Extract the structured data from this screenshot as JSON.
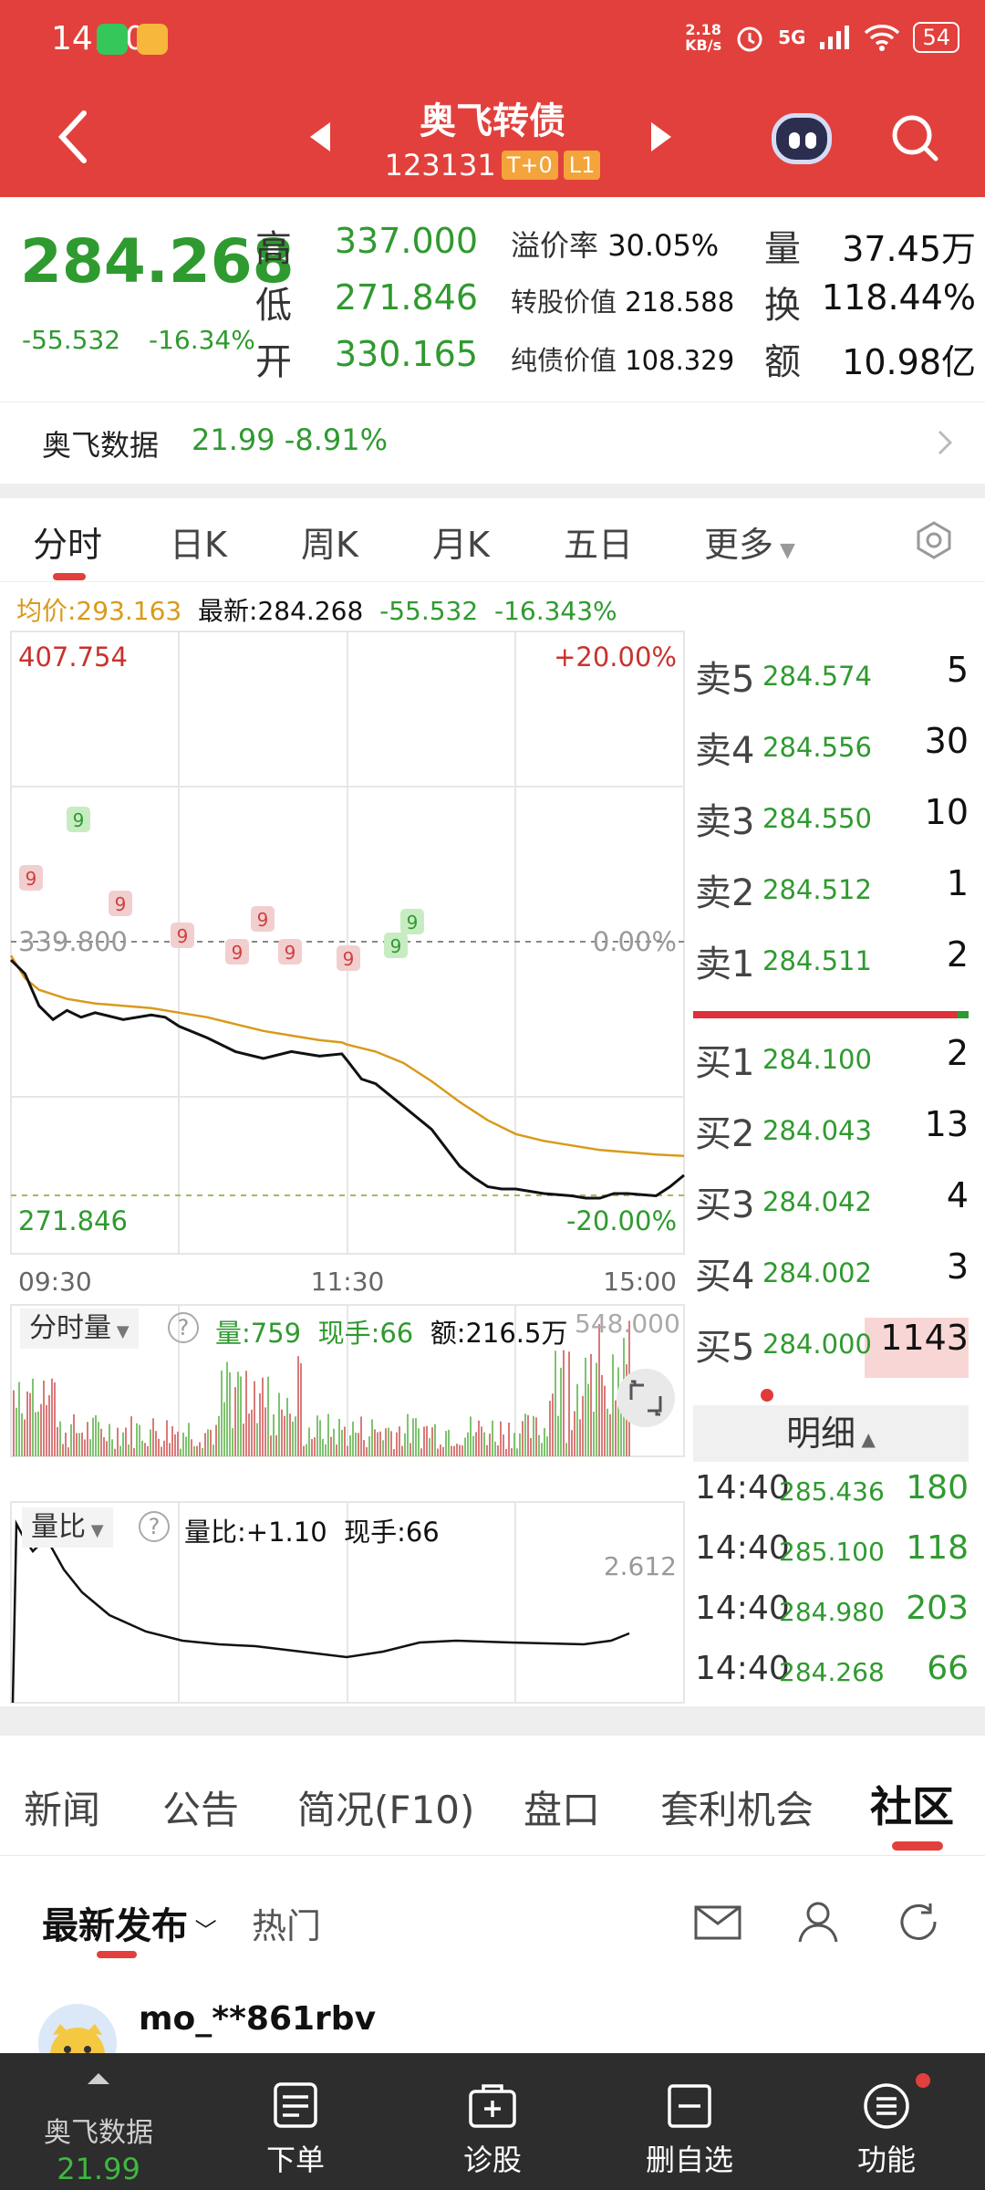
{
  "status": {
    "time": "14:40",
    "net_speed_top": "2.18",
    "net_speed_bottom": "KB/s",
    "signal": "5G",
    "battery": "54"
  },
  "header": {
    "title": "奥飞转债",
    "code": "123131",
    "tag_t0": "T+0",
    "tag_level": "L1"
  },
  "quote": {
    "last": "284.268",
    "change": "-55.532",
    "change_pct": "-16.34%",
    "high_label": "高",
    "high": "337.000",
    "low_label": "低",
    "low": "271.846",
    "open_label": "开",
    "open": "330.165",
    "premium_label": "溢价率",
    "premium": "30.05%",
    "conv_value_label": "转股价值",
    "conv_value": "218.588",
    "bond_value_label": "纯债价值",
    "bond_value": "108.329",
    "volume_label": "量",
    "volume": "37.45万",
    "turnover_label": "换",
    "turnover": "118.44%",
    "amount_label": "额",
    "amount": "10.98亿"
  },
  "stock": {
    "name": "奥飞数据",
    "price": "21.99",
    "change_pct": "-8.91%"
  },
  "period_tabs": [
    "分时",
    "日K",
    "周K",
    "月K",
    "五日",
    "更多"
  ],
  "chart_info": {
    "avg": "均价:293.163",
    "latest": "最新:284.268",
    "chg": "-55.532",
    "chg_pct": "-16.343%"
  },
  "chart_labels": {
    "max": "407.754",
    "max_pct": "+20.00%",
    "prev_close": "339.800",
    "zero_pct": "0.00%",
    "min": "271.846",
    "min_pct": "-20.00%",
    "t_start": "09:30",
    "t_mid": "11:30",
    "t_end": "15:00",
    "vol_label": "分时量",
    "vol_info": "量:759",
    "vol_hand": "现手:66",
    "vol_amt": "额:216.5万",
    "vol_max": "548.000",
    "ratio_label": "量比",
    "ratio_info": "量比:+1.10",
    "ratio_hand": "现手:66",
    "ratio_max": "2.612",
    "marker": "9"
  },
  "chart_data": {
    "type": "line",
    "x_range": [
      "09:30",
      "15:00"
    ],
    "y_range": [
      271.846,
      407.754
    ],
    "prev_close": 339.8,
    "series": [
      {
        "name": "price",
        "color": "#111111",
        "x": [
          0,
          5,
          10,
          15,
          20,
          25,
          30,
          40,
          50,
          55,
          60,
          70,
          80,
          90,
          100,
          110,
          118,
          120,
          125,
          130,
          140,
          150,
          155,
          160,
          165,
          170,
          175,
          180,
          190,
          200,
          205,
          210,
          215,
          220,
          230,
          235,
          240
        ],
        "values": [
          336.0,
          333.0,
          326.0,
          323.0,
          325.0,
          323.5,
          324.5,
          323.0,
          324.0,
          323.5,
          321.5,
          319.0,
          316.0,
          314.5,
          316.0,
          315.0,
          315.5,
          314.0,
          310.0,
          309.0,
          304.0,
          299.0,
          295.0,
          291.0,
          288.5,
          286.5,
          286.0,
          286.0,
          285.0,
          284.5,
          284.0,
          284.0,
          285.0,
          285.0,
          284.5,
          286.5,
          289.0
        ]
      },
      {
        "name": "均价",
        "color": "#d99a1a",
        "x": [
          0,
          5,
          10,
          20,
          30,
          40,
          50,
          60,
          70,
          80,
          90,
          100,
          110,
          118,
          120,
          130,
          140,
          150,
          160,
          170,
          180,
          190,
          200,
          210,
          220,
          230,
          240
        ],
        "values": [
          337.0,
          332.0,
          329.5,
          327.5,
          326.5,
          326.0,
          325.5,
          324.5,
          323.5,
          322.0,
          320.5,
          319.5,
          318.5,
          318.0,
          317.5,
          316.0,
          313.5,
          309.5,
          305.0,
          301.0,
          298.0,
          296.5,
          295.5,
          294.5,
          294.0,
          293.5,
          293.2
        ]
      }
    ]
  },
  "order_book": {
    "asks": [
      {
        "label": "卖5",
        "price": "284.574",
        "qty": "5"
      },
      {
        "label": "卖4",
        "price": "284.556",
        "qty": "30"
      },
      {
        "label": "卖3",
        "price": "284.550",
        "qty": "10"
      },
      {
        "label": "卖2",
        "price": "284.512",
        "qty": "1"
      },
      {
        "label": "卖1",
        "price": "284.511",
        "qty": "2"
      }
    ],
    "bids": [
      {
        "label": "买1",
        "price": "284.100",
        "qty": "2"
      },
      {
        "label": "买2",
        "price": "284.043",
        "qty": "13"
      },
      {
        "label": "买3",
        "price": "284.042",
        "qty": "4"
      },
      {
        "label": "买4",
        "price": "284.002",
        "qty": "3"
      },
      {
        "label": "买5",
        "price": "284.000",
        "qty": "1143"
      }
    ]
  },
  "trade_detail": {
    "header": "明细",
    "rows": [
      {
        "time": "14:40",
        "price": "285.436",
        "qty": "180"
      },
      {
        "time": "14:40",
        "price": "285.100",
        "qty": "118"
      },
      {
        "time": "14:40",
        "price": "284.980",
        "qty": "203"
      },
      {
        "time": "14:40",
        "price": "284.268",
        "qty": "66"
      }
    ]
  },
  "news_tabs": [
    "新闻",
    "公告",
    "简况(F10)",
    "盘口",
    "套利机会",
    "社区"
  ],
  "feed": {
    "latest": "最新发布",
    "hot": "热门",
    "user": "mo_**861rbv"
  },
  "bottom_nav": {
    "stock_name": "奥飞数据",
    "stock_price": "21.99",
    "order": "下单",
    "diagnose": "诊股",
    "remove": "删自选",
    "functions": "功能"
  },
  "colors": {
    "brand": "#e2403c",
    "down": "#2f9a2f",
    "up": "#e03a3a",
    "avg": "#d99a1a"
  }
}
